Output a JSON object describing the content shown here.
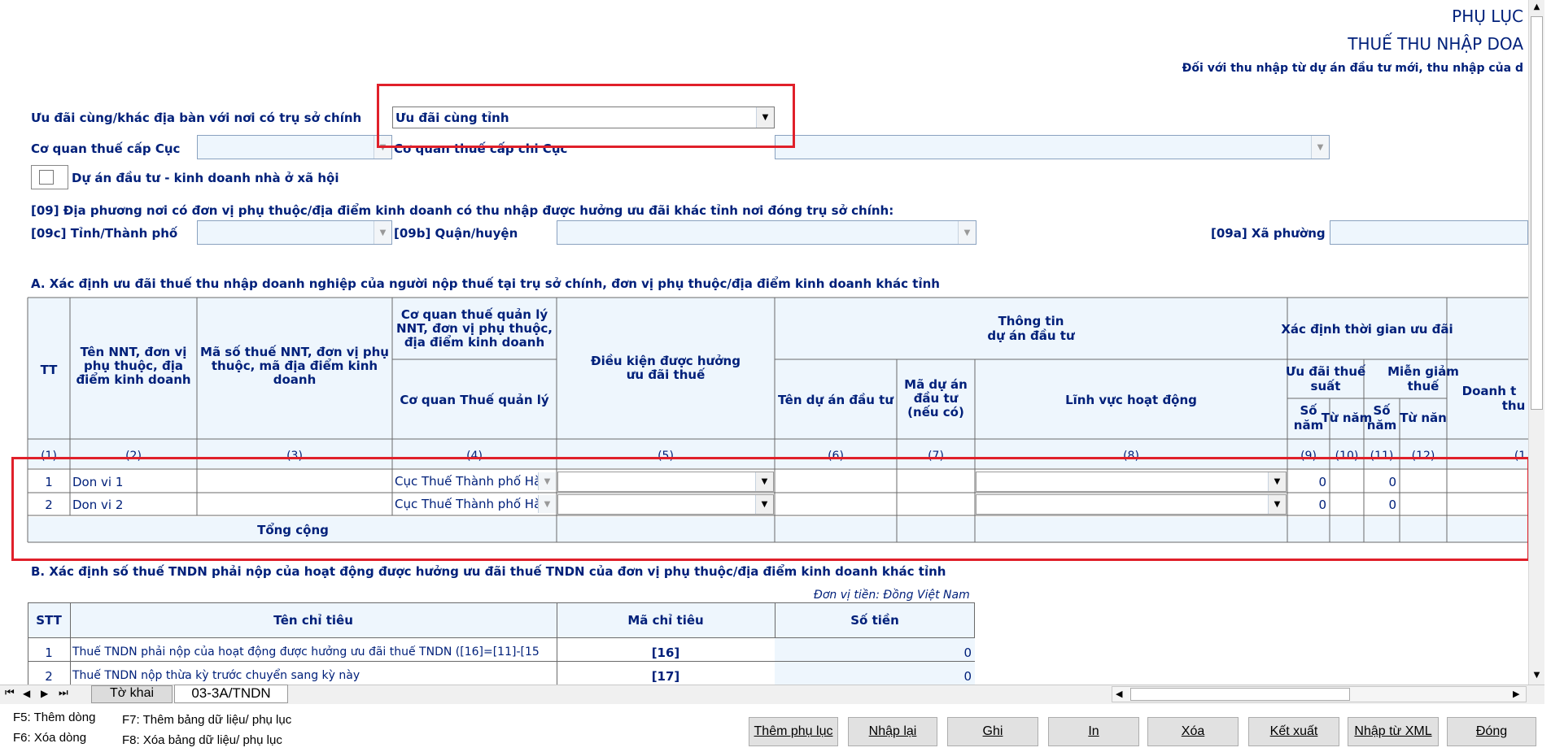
{
  "header": {
    "title1": "PHỤ LỤC",
    "title2": "THUẾ THU NHẬP DOA",
    "subtitle": "Đối với thu nhập từ dự án đầu tư mới, thu nhập của d"
  },
  "form": {
    "uu_dai_label": "Ưu đãi cùng/khác địa bàn với nơi  có trụ sở chính",
    "uu_dai_value": "Ưu đãi cùng tỉnh",
    "cqt_cuc_label": "Cơ quan thuế cấp Cục",
    "cqt_chicuc_label": "Cơ quan thuế cấp chi Cục",
    "nha_o_xa_hoi_label": "Dự án đầu tư - kinh doanh nhà ở xã hội",
    "dia_phuong_label": "[09] Địa phương nơi có đơn vị phụ thuộc/địa điểm kinh doanh có thu nhập được hưởng ưu đãi khác tỉnh nơi đóng trụ sở chính:",
    "tinh_label": "[09c] Tỉnh/Thành phố",
    "quan_label": "[09b]  Quận/huyện",
    "xa_label": "[09a] Xã phường"
  },
  "sectionA": {
    "title": "A. Xác định ưu đãi thuế thu nhập doanh nghiệp của người nộp thuế tại trụ sở chính, đơn vị phụ thuộc/địa điểm kinh doanh khác tỉnh",
    "h": {
      "tt": "TT",
      "ten1": "Tên NNT, đơn vị",
      "ten2": "phụ thuộc, địa",
      "ten3": "điểm kinh doanh",
      "mst1": "Mã số thuế NNT, đơn vị phụ",
      "mst2": "thuộc, mã địa điểm kinh",
      "mst3": "doanh",
      "cq1": "Cơ quan thuế quản lý",
      "cq2": "NNT, đơn vị phụ thuộc,",
      "cq3": "địa điểm kinh doanh",
      "cqql": "Cơ quan Thuế quản lý",
      "dk1": "Điều kiện được hưởng",
      "dk2": "ưu đãi thuế",
      "tt1": "Thông tin",
      "tt2": "dự án đầu tư",
      "tenda": "Tên dự án đầu tư",
      "mada1": "Mã dự án",
      "mada2": "đầu tư",
      "mada3": "(nếu có)",
      "linhvuc": "Lĩnh vực hoạt động",
      "xdtg": "Xác định thời gian ưu đãi",
      "udts1": "Ưu đãi thuế",
      "udts2": "suất",
      "mg1": "Miễn giảm",
      "mg2": "thuế",
      "sonam1": "Số",
      "sonam2": "năm",
      "tunam": "Từ năm",
      "tunam_b": "Từ năn",
      "dt1": "Doanh t",
      "dt2": "thu",
      "c1": "(1)",
      "c2": "(2)",
      "c3": "(3)",
      "c4": "(4)",
      "c5": "(5)",
      "c6": "(6)",
      "c7": "(7)",
      "c8": "(8)",
      "c9": "(9)",
      "c10": "(10)",
      "c11": "(11)",
      "c12": "(12)",
      "c13": "(1"
    },
    "rows": [
      {
        "tt": "1",
        "ten": "Don vi 1",
        "cq": "Cục Thuế Thành phố Hà",
        "so_nam_9": "0",
        "so_nam_11": "0"
      },
      {
        "tt": "2",
        "ten": "Don vi 2",
        "cq": "Cục Thuế Thành phố Hà",
        "so_nam_9": "0",
        "so_nam_11": "0"
      }
    ],
    "total_label": "Tổng cộng"
  },
  "sectionB": {
    "title": "B. Xác định số thuế TNDN phải nộp của hoạt động được hưởng ưu đãi thuế TNDN của đơn vị phụ thuộc/địa điểm kinh doanh khác tỉnh",
    "unit": "Đơn vị tiền: Đồng Việt Nam",
    "h_stt": "STT",
    "h_ten": "Tên chỉ tiêu",
    "h_ma": "Mã chỉ tiêu",
    "h_sotien": "Số tiền",
    "rows": [
      {
        "stt": "1",
        "ten": "Thuế TNDN phải nộp của hoạt động được hưởng ưu đãi thuế TNDN ([16]=[11]-[15",
        "ma": "[16]",
        "sotien": "0"
      },
      {
        "stt": "2",
        "ten": "Thuế TNDN nộp thừa kỳ trước chuyển sang kỳ này",
        "ma": "[17]",
        "sotien": "0"
      }
    ]
  },
  "tabs": {
    "tab1": "Tờ khai",
    "tab2": "03-3A/TNDN"
  },
  "hints": {
    "f5": "F5: Thêm dòng",
    "f6": "F6: Xóa dòng",
    "f7": "F7: Thêm bảng dữ liệu/ phụ lục",
    "f8": "F8: Xóa bảng dữ liệu/ phụ lục"
  },
  "buttons": {
    "them_phu_luc": "Thêm phụ lục",
    "nhap_lai": "Nhập lại",
    "ghi": "Ghi",
    "in": "In",
    "xoa": "Xóa",
    "ket_xuat": "Kết xuất",
    "nhap_xml": "Nhập từ XML",
    "dong": "Đóng"
  },
  "colors": {
    "navy": "#00207a",
    "highlight": "#e0202a",
    "field": "#eef6fd"
  }
}
